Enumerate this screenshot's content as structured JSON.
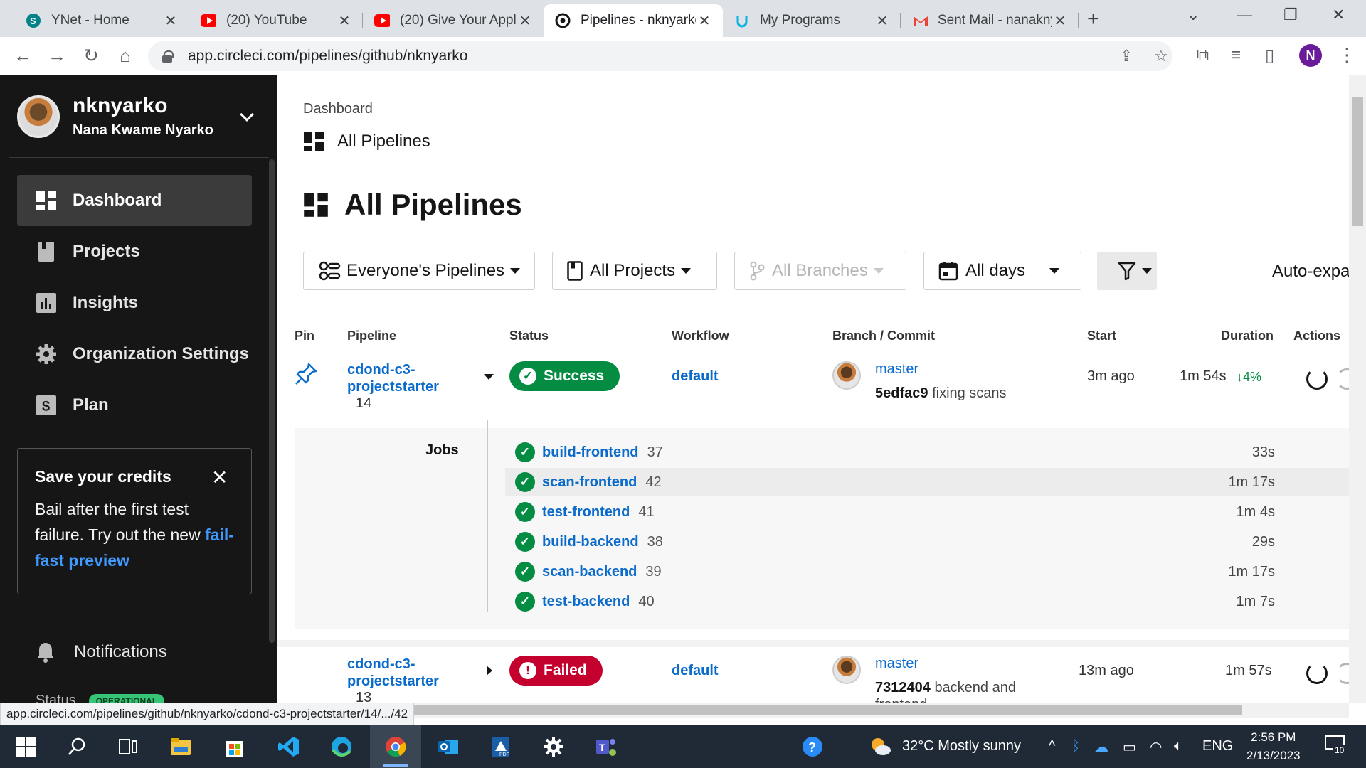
{
  "browser": {
    "tabs": [
      {
        "title": "YNet - Home",
        "icon": "sharepoint-icon"
      },
      {
        "title": "(20) YouTube",
        "icon": "youtube-icon"
      },
      {
        "title": "(20) Give Your Appl",
        "icon": "youtube-icon"
      },
      {
        "title": "Pipelines - nknyarko",
        "icon": "circleci-icon",
        "active": true
      },
      {
        "title": "My Programs",
        "icon": "udacity-icon"
      },
      {
        "title": "Sent Mail - nanakny",
        "icon": "gmail-icon"
      }
    ],
    "url": "app.circleci.com/pipelines/github/nknyarko",
    "profile_initial": "N",
    "status_url": "app.circleci.com/pipelines/github/nknyarko/cdond-c3-projectstarter/14/.../42"
  },
  "sidebar": {
    "username": "nknyarko",
    "full_name": "Nana Kwame Nyarko",
    "nav": [
      {
        "label": "Dashboard",
        "icon": "dashboard-icon",
        "active": true
      },
      {
        "label": "Projects",
        "icon": "projects-icon"
      },
      {
        "label": "Insights",
        "icon": "insights-icon"
      },
      {
        "label": "Organization Settings",
        "icon": "gear-icon"
      },
      {
        "label": "Plan",
        "icon": "dollar-icon"
      }
    ],
    "credits": {
      "title": "Save your credits",
      "body": "Bail after the first test failure. Try out the new",
      "link": "fail-fast preview"
    },
    "notifications": "Notifications",
    "status_label": "Status",
    "status_badge": "OPERATIONAL"
  },
  "main": {
    "breadcrumb": "Dashboard",
    "subheading": "All Pipelines",
    "title": "All Pipelines",
    "filters": {
      "pipelines": "Everyone's Pipelines",
      "projects": "All Projects",
      "branches": "All Branches",
      "days": "All days",
      "auto_expand": "Auto-expa"
    },
    "columns": [
      "Pin",
      "Pipeline",
      "Status",
      "Workflow",
      "Branch / Commit",
      "Start",
      "Duration",
      "Actions"
    ],
    "pipelines": [
      {
        "name_line1": "cdond-c3-",
        "name_line2": "projectstarter",
        "number": "14",
        "status": "Success",
        "workflow": "default",
        "branch": "master",
        "commit_hash": "5edfac9",
        "commit_msg": "fixing scans",
        "start": "3m ago",
        "duration": "1m 54s",
        "duration_change": "4%",
        "jobs_label": "Jobs",
        "jobs": [
          {
            "name": "build-frontend",
            "number": "37",
            "duration": "33s"
          },
          {
            "name": "scan-frontend",
            "number": "42",
            "duration": "1m 17s"
          },
          {
            "name": "test-frontend",
            "number": "41",
            "duration": "1m 4s"
          },
          {
            "name": "build-backend",
            "number": "38",
            "duration": "29s"
          },
          {
            "name": "scan-backend",
            "number": "39",
            "duration": "1m 17s"
          },
          {
            "name": "test-backend",
            "number": "40",
            "duration": "1m 7s"
          }
        ]
      },
      {
        "name_line1": "cdond-c3-",
        "name_line2": "projectstarter",
        "number": "13",
        "status": "Failed",
        "workflow": "default",
        "branch": "master",
        "commit_hash": "7312404",
        "commit_msg": "backend and",
        "commit_msg_2": "frontend",
        "start": "13m ago",
        "duration": "1m 57s"
      }
    ]
  },
  "taskbar": {
    "weather": "32°C  Mostly sunny",
    "language": "ENG",
    "time": "2:56 PM",
    "date": "2/13/2023",
    "notification_count": "10"
  },
  "colors": {
    "success": "#048c43",
    "failed": "#c3002e",
    "link": "#0b6bcb",
    "sidebar_bg": "#161616"
  }
}
